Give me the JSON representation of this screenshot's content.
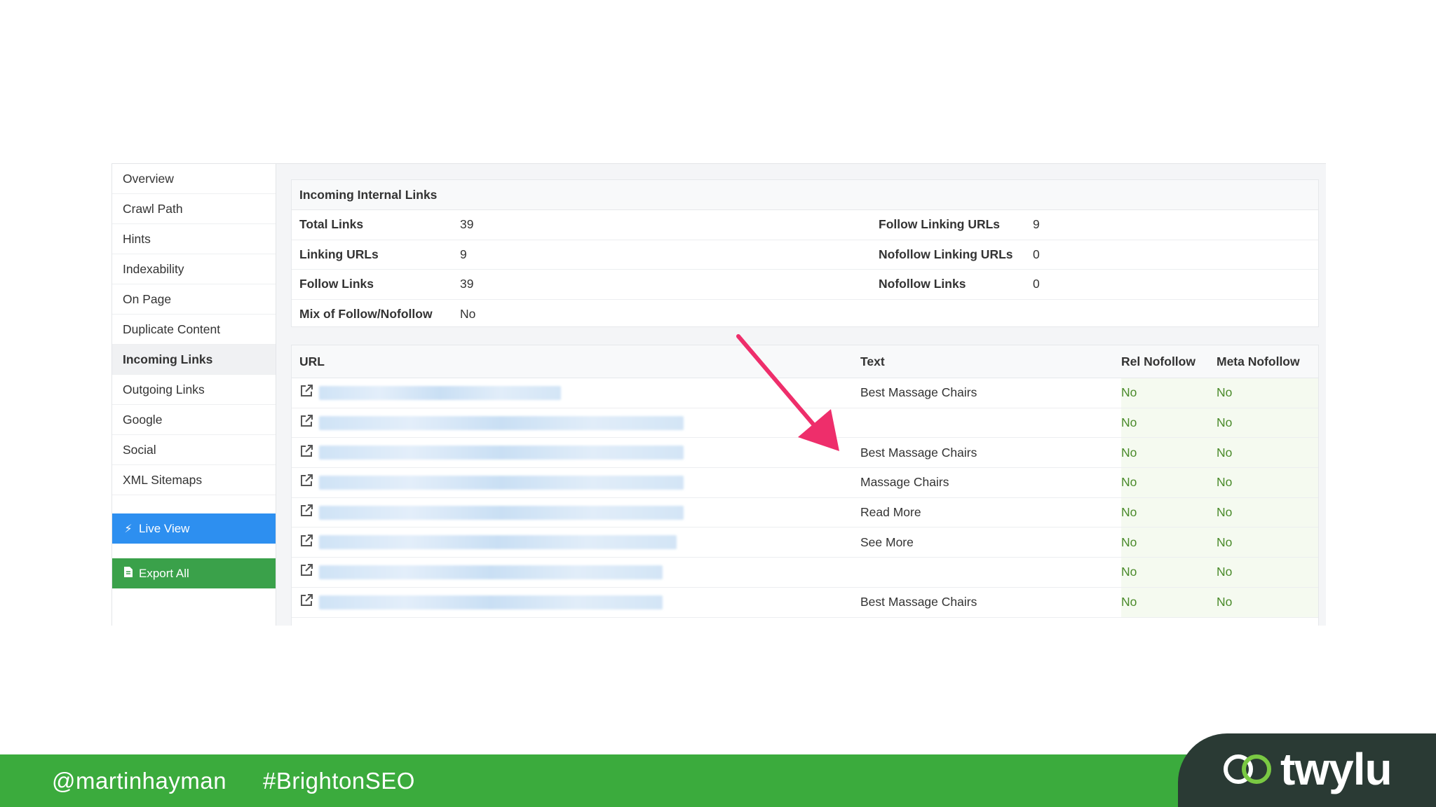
{
  "sidebar": {
    "items": [
      {
        "label": "Overview"
      },
      {
        "label": "Crawl Path"
      },
      {
        "label": "Hints"
      },
      {
        "label": "Indexability"
      },
      {
        "label": "On Page"
      },
      {
        "label": "Duplicate Content"
      },
      {
        "label": "Incoming Links",
        "active": true
      },
      {
        "label": "Outgoing Links"
      },
      {
        "label": "Google"
      },
      {
        "label": "Social"
      },
      {
        "label": "XML Sitemaps"
      }
    ],
    "live_view_label": "Live View",
    "export_all_label": "Export All"
  },
  "summary": {
    "title": "Incoming Internal Links",
    "total_links_label": "Total Links",
    "total_links_value": "39",
    "linking_urls_label": "Linking URLs",
    "linking_urls_value": "9",
    "follow_links_label": "Follow Links",
    "follow_links_value": "39",
    "mix_label": "Mix of Follow/Nofollow",
    "mix_value": "No",
    "follow_linking_urls_label": "Follow Linking URLs",
    "follow_linking_urls_value": "9",
    "nofollow_linking_urls_label": "Nofollow Linking URLs",
    "nofollow_linking_urls_value": "0",
    "nofollow_links_label": "Nofollow Links",
    "nofollow_links_value": "0"
  },
  "links_table": {
    "headers": {
      "url": "URL",
      "text": "Text",
      "rel": "Rel Nofollow",
      "meta": "Meta Nofollow"
    },
    "rows": [
      {
        "text": "Best Massage Chairs",
        "rel": "No",
        "meta": "No"
      },
      {
        "text": "",
        "rel": "No",
        "meta": "No"
      },
      {
        "text": "Best Massage Chairs",
        "rel": "No",
        "meta": "No"
      },
      {
        "text": "Massage Chairs",
        "rel": "No",
        "meta": "No"
      },
      {
        "text": "Read More",
        "rel": "No",
        "meta": "No"
      },
      {
        "text": "See More",
        "rel": "No",
        "meta": "No"
      },
      {
        "text": "",
        "rel": "No",
        "meta": "No"
      },
      {
        "text": "Best Massage Chairs",
        "rel": "No",
        "meta": "No"
      }
    ]
  },
  "footer": {
    "handle": "@martinhayman",
    "hashtag": "#BrightonSEO",
    "logo_text": "twylu"
  },
  "colors": {
    "accent_arrow": "#ee2e6b",
    "live_view_button": "#2d8ff0",
    "export_button": "#3aa14a",
    "footer_green": "#3bab3d",
    "logo_dark": "#2a3a34"
  }
}
